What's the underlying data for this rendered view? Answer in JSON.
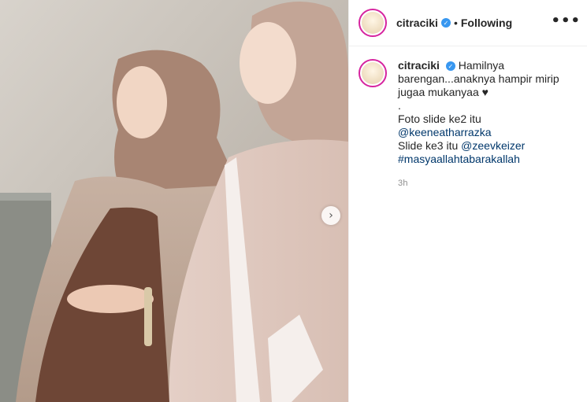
{
  "photo": {
    "alt_icon": "chevron-right-icon",
    "next_glyph": "›"
  },
  "post_header": {
    "username": "citraciki",
    "verified_icon": "✓",
    "separator": "•",
    "follow_status": "Following",
    "more_glyph": "•••"
  },
  "caption": {
    "username": "citraciki",
    "line1": "Hamilnya",
    "line2": "barengan...anaknya hampir mirip",
    "line3": "jugaa mukanyaa",
    "heart": "♥",
    "line4": ".",
    "line5_prefix": "Foto slide ke2 itu ",
    "line5_mention": "@keeneatharrazka",
    "line6_prefix": "Slide ke3 itu ",
    "line6_mention": "@zeevkeizer",
    "hashtag": "#masyaallahtabarakallah",
    "time": "3h"
  },
  "colors": {
    "link": "#00376b",
    "verified": "#3897f0",
    "story_ring": "#d6249f",
    "muted": "#8e8e8e"
  }
}
